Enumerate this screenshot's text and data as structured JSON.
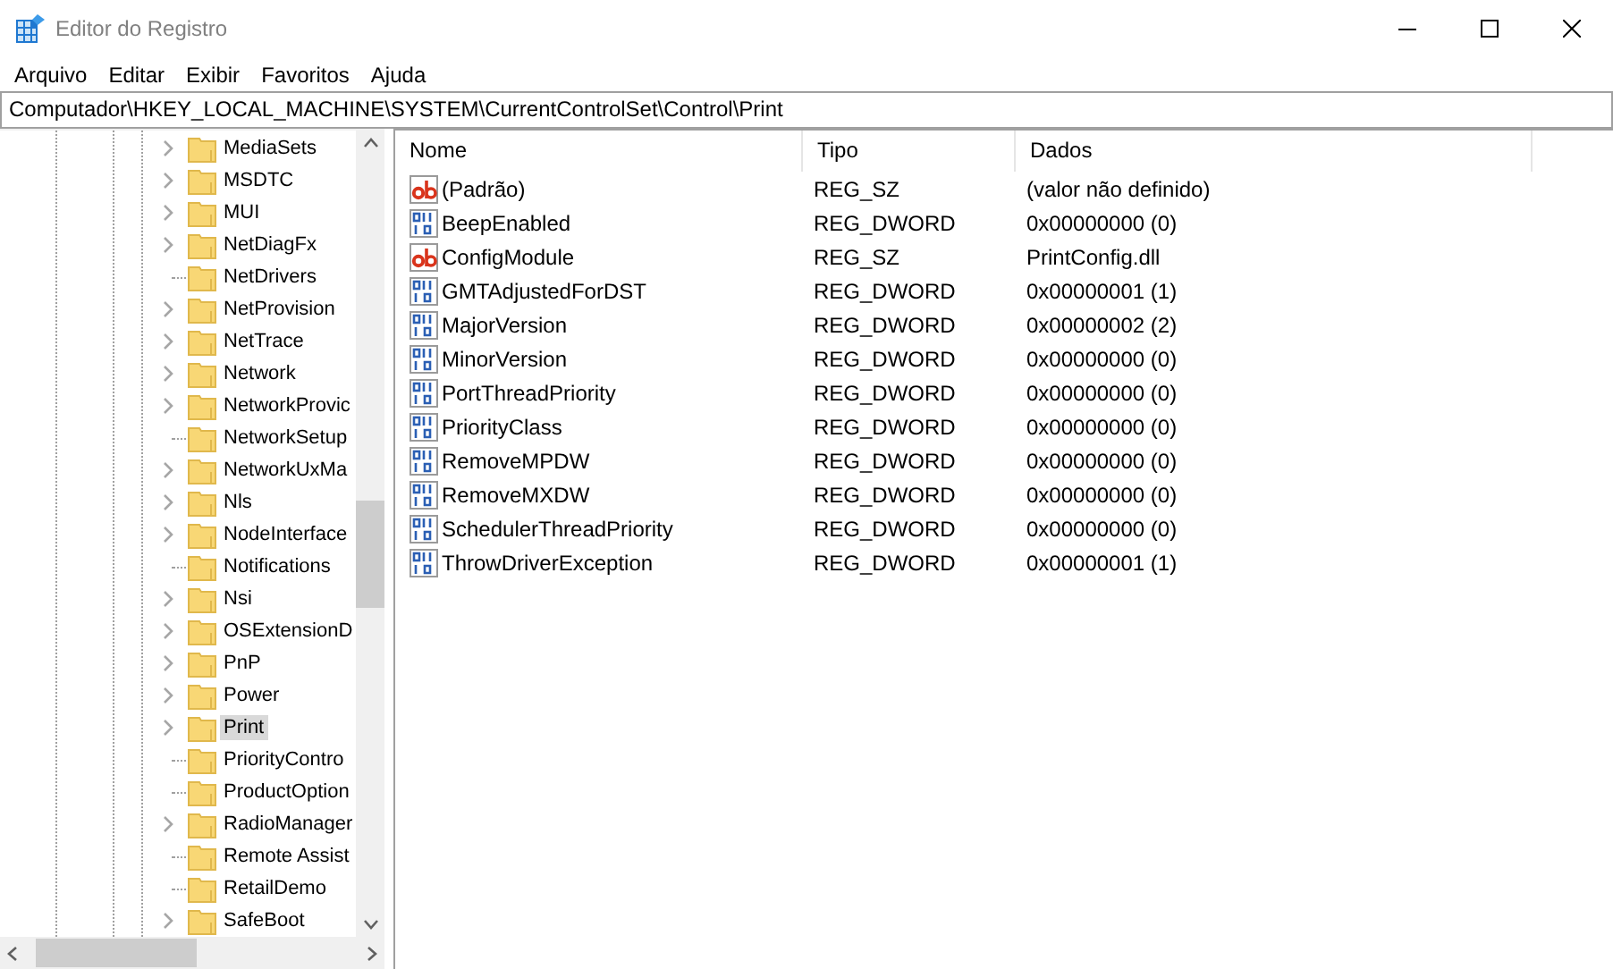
{
  "window": {
    "title": "Editor do Registro"
  },
  "menu": [
    "Arquivo",
    "Editar",
    "Exibir",
    "Favoritos",
    "Ajuda"
  ],
  "address": "Computador\\HKEY_LOCAL_MACHINE\\SYSTEM\\CurrentControlSet\\Control\\Print",
  "tree": {
    "items": [
      {
        "label": "MediaSets",
        "expandable": true,
        "selected": false
      },
      {
        "label": "MSDTC",
        "expandable": true,
        "selected": false
      },
      {
        "label": "MUI",
        "expandable": true,
        "selected": false
      },
      {
        "label": "NetDiagFx",
        "expandable": true,
        "selected": false
      },
      {
        "label": "NetDrivers",
        "expandable": false,
        "selected": false
      },
      {
        "label": "NetProvision",
        "expandable": true,
        "selected": false
      },
      {
        "label": "NetTrace",
        "expandable": true,
        "selected": false
      },
      {
        "label": "Network",
        "expandable": true,
        "selected": false
      },
      {
        "label": "NetworkProvic",
        "expandable": true,
        "selected": false
      },
      {
        "label": "NetworkSetup",
        "expandable": false,
        "selected": false
      },
      {
        "label": "NetworkUxMa",
        "expandable": true,
        "selected": false
      },
      {
        "label": "Nls",
        "expandable": true,
        "selected": false
      },
      {
        "label": "NodeInterface",
        "expandable": true,
        "selected": false
      },
      {
        "label": "Notifications",
        "expandable": false,
        "selected": false
      },
      {
        "label": "Nsi",
        "expandable": true,
        "selected": false
      },
      {
        "label": "OSExtensionD",
        "expandable": true,
        "selected": false
      },
      {
        "label": "PnP",
        "expandable": true,
        "selected": false
      },
      {
        "label": "Power",
        "expandable": true,
        "selected": false
      },
      {
        "label": "Print",
        "expandable": true,
        "selected": true
      },
      {
        "label": "PriorityContro",
        "expandable": false,
        "selected": false
      },
      {
        "label": "ProductOption",
        "expandable": false,
        "selected": false
      },
      {
        "label": "RadioManager",
        "expandable": true,
        "selected": false
      },
      {
        "label": "Remote Assist",
        "expandable": false,
        "selected": false
      },
      {
        "label": "RetailDemo",
        "expandable": false,
        "selected": false
      },
      {
        "label": "SafeBoot",
        "expandable": true,
        "selected": false
      }
    ]
  },
  "list": {
    "columns": [
      "Nome",
      "Tipo",
      "Dados"
    ],
    "rows": [
      {
        "name": "(Padrão)",
        "type": "REG_SZ",
        "data": "(valor não definido)",
        "kind": "string"
      },
      {
        "name": "BeepEnabled",
        "type": "REG_DWORD",
        "data": "0x00000000 (0)",
        "kind": "dword"
      },
      {
        "name": "ConfigModule",
        "type": "REG_SZ",
        "data": "PrintConfig.dll",
        "kind": "string"
      },
      {
        "name": "GMTAdjustedForDST",
        "type": "REG_DWORD",
        "data": "0x00000001 (1)",
        "kind": "dword"
      },
      {
        "name": "MajorVersion",
        "type": "REG_DWORD",
        "data": "0x00000002 (2)",
        "kind": "dword"
      },
      {
        "name": "MinorVersion",
        "type": "REG_DWORD",
        "data": "0x00000000 (0)",
        "kind": "dword"
      },
      {
        "name": "PortThreadPriority",
        "type": "REG_DWORD",
        "data": "0x00000000 (0)",
        "kind": "dword"
      },
      {
        "name": "PriorityClass",
        "type": "REG_DWORD",
        "data": "0x00000000 (0)",
        "kind": "dword"
      },
      {
        "name": "RemoveMPDW",
        "type": "REG_DWORD",
        "data": "0x00000000 (0)",
        "kind": "dword"
      },
      {
        "name": "RemoveMXDW",
        "type": "REG_DWORD",
        "data": "0x00000000 (0)",
        "kind": "dword"
      },
      {
        "name": "SchedulerThreadPriority",
        "type": "REG_DWORD",
        "data": "0x00000000 (0)",
        "kind": "dword"
      },
      {
        "name": "ThrowDriverException",
        "type": "REG_DWORD",
        "data": "0x00000001 (1)",
        "kind": "dword"
      }
    ]
  }
}
